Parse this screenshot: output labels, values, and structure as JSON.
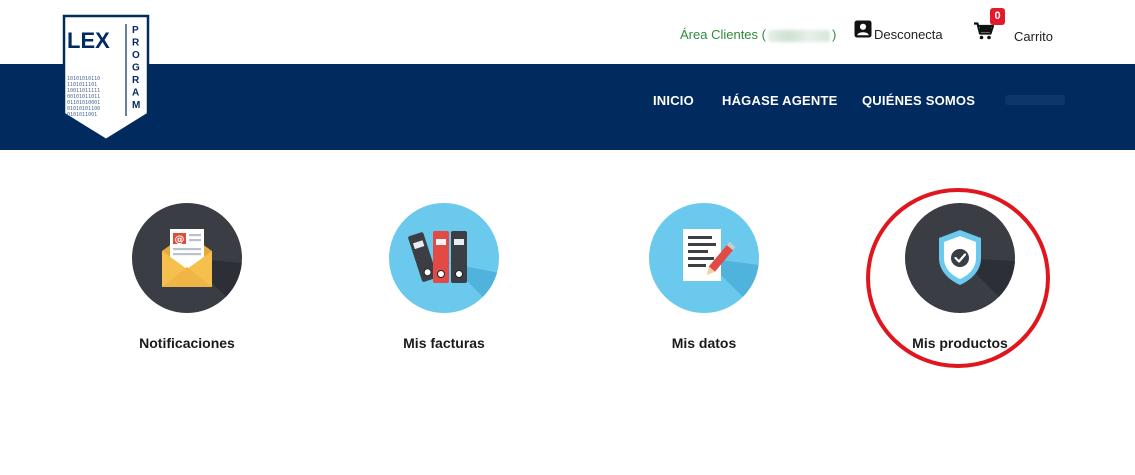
{
  "brand": {
    "logo_text": "LEX",
    "logo_vertical": "PROGRAM",
    "logo_binary": [
      "10101010110",
      "1101011101",
      "10011011111",
      "00101011011",
      "01101010001",
      "01010101100",
      "0101011001"
    ]
  },
  "topbar": {
    "area_clientes_prefix": "Área Clientes (",
    "area_clientes_suffix": ")",
    "disconnect_label": "Desconecta",
    "cart_count": "0",
    "cart_label": "Carrito"
  },
  "nav": {
    "items": [
      "INICIO",
      "HÁGASE AGENTE",
      "QUIÉNES SOMOS"
    ]
  },
  "tiles": [
    {
      "label": "Notificaciones",
      "icon": "mail-icon"
    },
    {
      "label": "Mis facturas",
      "icon": "binders-icon"
    },
    {
      "label": "Mis datos",
      "icon": "document-edit-icon"
    },
    {
      "label": "Mis productos",
      "icon": "shield-check-icon"
    }
  ],
  "colors": {
    "navy": "#012a5f",
    "green_text": "#2e8b3a",
    "badge_red": "#e21b2c",
    "dark_circle": "#3a3d44",
    "light_circle": "#6cc9ee",
    "highlight": "#e0161f"
  }
}
